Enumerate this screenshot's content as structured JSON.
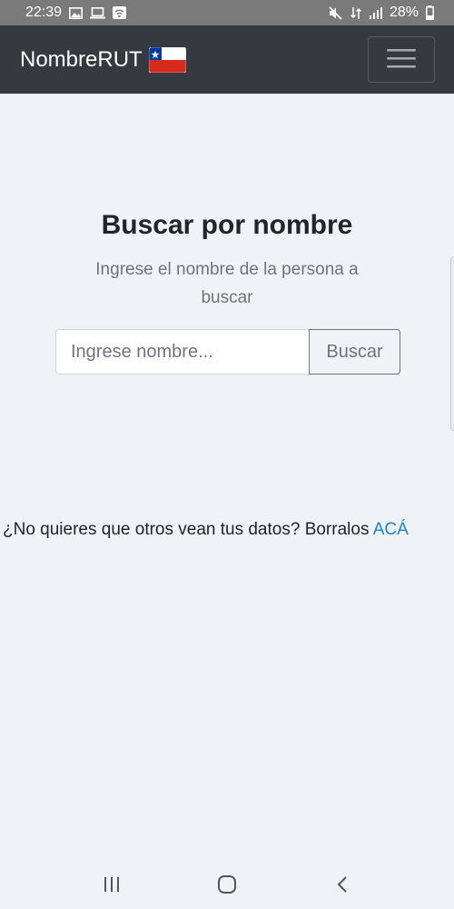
{
  "status_bar": {
    "time": "22:39",
    "battery": "28%",
    "icons_left": [
      "image-icon",
      "laptop-icon",
      "wifi-notification-icon"
    ],
    "icons_right": [
      "mute-icon",
      "data-icon",
      "signal-icon"
    ]
  },
  "navbar": {
    "brand": "NombreRUT",
    "flag": "chile-flag-icon",
    "toggler": "menu-icon"
  },
  "main": {
    "title": "Buscar por nombre",
    "subtitle": "Ingrese el nombre de la persona a buscar",
    "search": {
      "placeholder": "Ingrese nombre...",
      "value": "",
      "button": "Buscar"
    },
    "notice_text": "¿No quieres que otros vean tus datos? Borralos ",
    "notice_link": "ACÁ"
  },
  "android_nav": {
    "buttons": [
      "recents-icon",
      "home-icon",
      "back-icon"
    ]
  },
  "colors": {
    "navbar_bg": "#343a40",
    "page_bg": "#eff3f5",
    "link": "#1a82d6",
    "muted": "#6c757d",
    "status_bar_bg": "#7a7a7a"
  }
}
